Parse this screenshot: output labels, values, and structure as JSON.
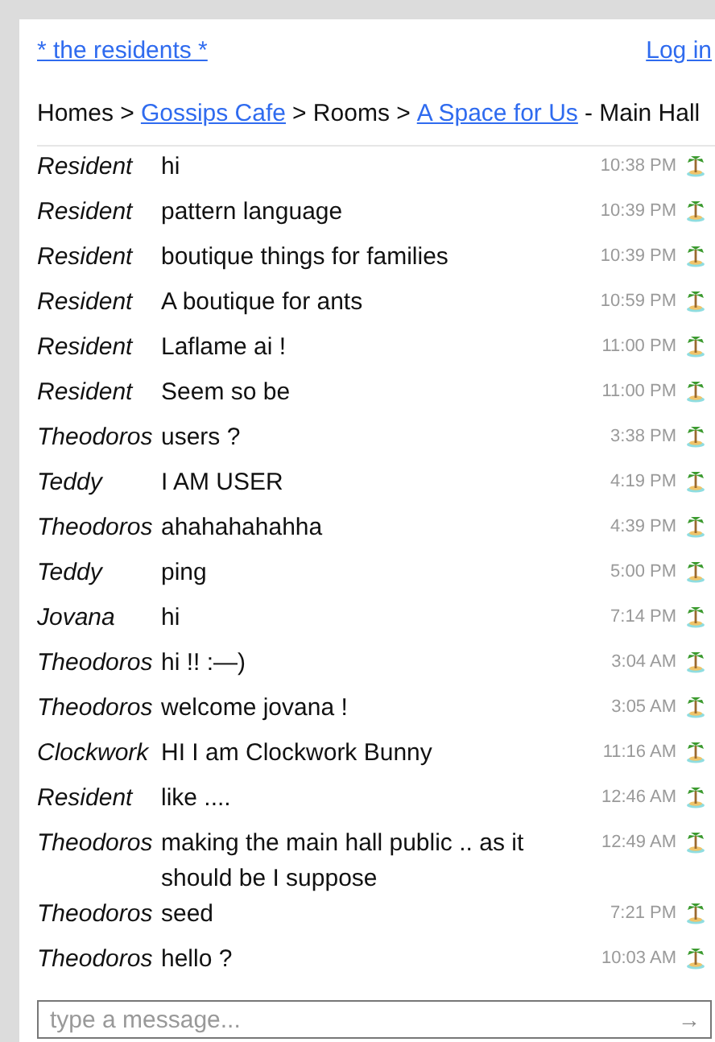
{
  "header": {
    "site_link": "* the residents *",
    "login_link": "Log in"
  },
  "breadcrumb": [
    {
      "text": "Homes >",
      "kind": "text"
    },
    {
      "text": "Gossips Cafe",
      "kind": "link"
    },
    {
      "text": "> Rooms >",
      "kind": "text"
    },
    {
      "text": "A Space for Us",
      "kind": "link"
    },
    {
      "text": "- Main Hall",
      "kind": "text"
    }
  ],
  "messages": [
    {
      "author": "Resident",
      "text": "hi",
      "time": "10:38 PM"
    },
    {
      "author": "Resident",
      "text": "pattern language",
      "time": "10:39 PM"
    },
    {
      "author": "Resident",
      "text": "boutique things for families",
      "time": "10:39 PM"
    },
    {
      "author": "Resident",
      "text": "A boutique for ants",
      "time": "10:59 PM"
    },
    {
      "author": "Resident",
      "text": "Laflame ai !",
      "time": "11:00 PM"
    },
    {
      "author": "Resident",
      "text": "Seem so be",
      "time": "11:00 PM"
    },
    {
      "author": "Theodoros",
      "text": "users ?",
      "time": "3:38 PM"
    },
    {
      "author": "Teddy",
      "text": "I AM USER",
      "time": "4:19 PM"
    },
    {
      "author": "Theodoros",
      "text": "ahahahahahha",
      "time": "4:39 PM"
    },
    {
      "author": "Teddy",
      "text": "ping",
      "time": "5:00 PM"
    },
    {
      "author": "Jovana",
      "text": "hi",
      "time": "7:14 PM"
    },
    {
      "author": "Theodoros",
      "text": "hi !! :—)",
      "time": "3:04 AM"
    },
    {
      "author": "Theodoros",
      "text": "welcome jovana !",
      "time": "3:05 AM"
    },
    {
      "author": "Clockwork",
      "text": "HI I am Clockwork Bunny",
      "time": "11:16 AM"
    },
    {
      "author": "Resident",
      "text": "like ....",
      "time": "12:46 AM"
    },
    {
      "author": "Theodoros",
      "text": "making the main hall public .. as it should be I suppose",
      "time": "12:49 AM"
    },
    {
      "author": "Theodoros",
      "text": "seed",
      "time": "7:21 PM"
    },
    {
      "author": "Theodoros",
      "text": "hello ?",
      "time": "10:03 AM"
    }
  ],
  "composer": {
    "placeholder": "type a message...",
    "send": "→"
  }
}
